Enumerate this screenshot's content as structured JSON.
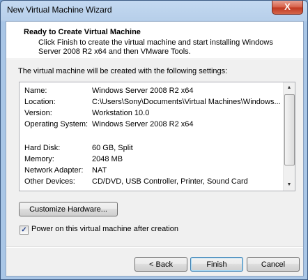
{
  "window": {
    "title": "New Virtual Machine Wizard",
    "close_glyph": "X"
  },
  "header": {
    "title": "Ready to Create Virtual Machine",
    "description": "Click Finish to create the virtual machine and start installing Windows Server 2008 R2 x64 and then VMware Tools."
  },
  "intro": "The virtual machine will be created with the following settings:",
  "settings": [
    {
      "key": "Name:",
      "value": "Windows Server 2008 R2 x64"
    },
    {
      "key": "Location:",
      "value": "C:\\Users\\Sony\\Documents\\Virtual Machines\\Windows..."
    },
    {
      "key": "Version:",
      "value": "Workstation 10.0"
    },
    {
      "key": "Operating System:",
      "value": "Windows Server 2008 R2 x64"
    },
    {
      "key": "Hard Disk:",
      "value": "60 GB, Split"
    },
    {
      "key": "Memory:",
      "value": "2048 MB"
    },
    {
      "key": "Network Adapter:",
      "value": "NAT"
    },
    {
      "key": "Other Devices:",
      "value": "CD/DVD, USB Controller, Printer, Sound Card"
    }
  ],
  "scrollbar": {
    "up_icon": "▲",
    "down_icon": "▼"
  },
  "customize_button": "Customize Hardware...",
  "power_on": {
    "label": "Power on this virtual machine after creation",
    "checked": true,
    "check_glyph": "✓"
  },
  "buttons": {
    "back": "< Back",
    "finish": "Finish",
    "cancel": "Cancel"
  }
}
